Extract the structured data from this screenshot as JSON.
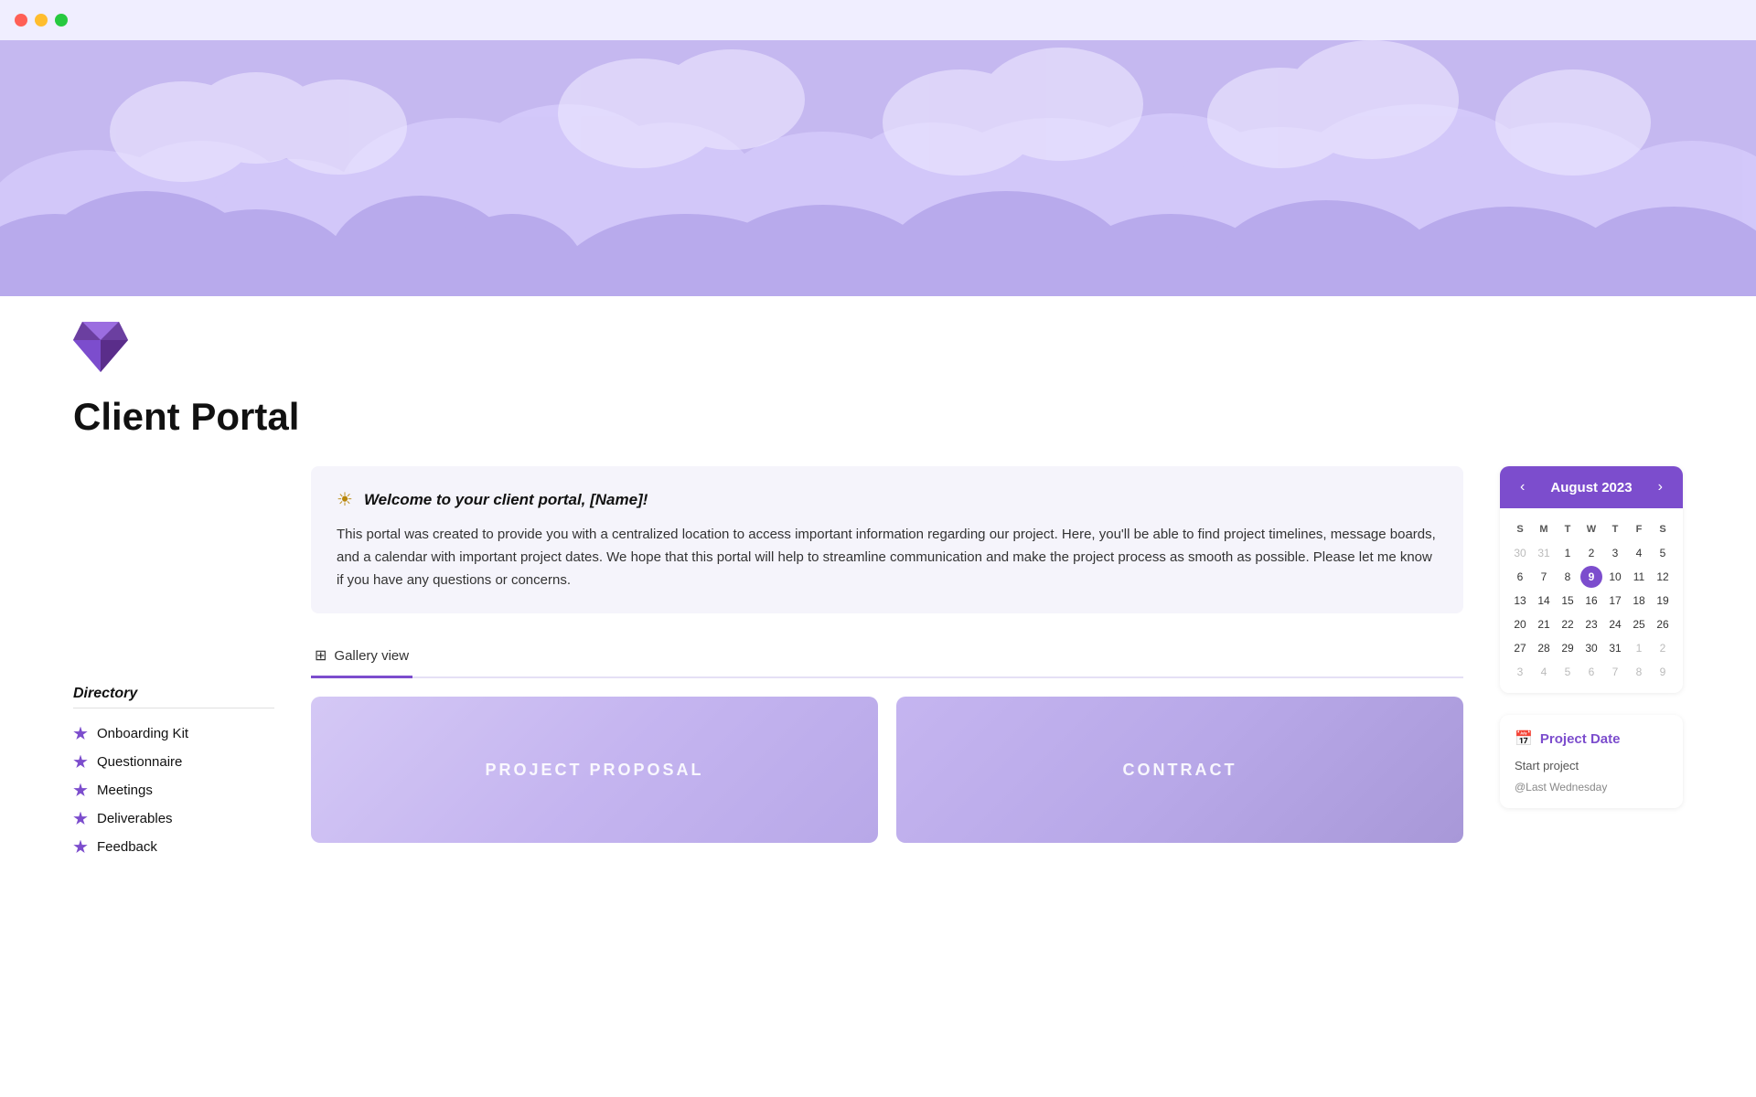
{
  "titlebar": {
    "btn_red": "close",
    "btn_yellow": "minimize",
    "btn_green": "maximize"
  },
  "hero": {
    "background_color": "#c5b8f0"
  },
  "icon": {
    "type": "diamond",
    "color": "#6b3fa0"
  },
  "page": {
    "title": "Client Portal"
  },
  "welcome": {
    "icon": "☀",
    "title": "Welcome to your client portal, [Name]!",
    "body": "This portal was created to provide you with a centralized location to access important information regarding our project. Here, you'll be able to find project timelines, message boards, and a calendar with important project dates. We hope that this portal will help to streamline communication and make the project process as smooth as possible. Please let me know if you have any questions or concerns."
  },
  "gallery_tab": {
    "label": "Gallery view"
  },
  "cards": [
    {
      "id": "proposal",
      "label": "PROJECT PROPOSAL"
    },
    {
      "id": "contract",
      "label": "CONTRACT"
    }
  ],
  "sidebar": {
    "title": "Directory",
    "items": [
      {
        "label": "Onboarding Kit"
      },
      {
        "label": "Questionnaire"
      },
      {
        "label": "Meetings"
      },
      {
        "label": "Deliverables"
      },
      {
        "label": "Feedback"
      }
    ]
  },
  "calendar": {
    "prev_label": "‹",
    "next_label": "›",
    "month_year": "August 2023",
    "day_headers": [
      "S",
      "M",
      "T",
      "W",
      "T",
      "F",
      "S"
    ],
    "weeks": [
      [
        {
          "n": "30",
          "other": true
        },
        {
          "n": "31",
          "other": true
        },
        {
          "n": "1"
        },
        {
          "n": "2"
        },
        {
          "n": "3"
        },
        {
          "n": "4"
        },
        {
          "n": "5"
        }
      ],
      [
        {
          "n": "6"
        },
        {
          "n": "7"
        },
        {
          "n": "8"
        },
        {
          "n": "9",
          "today": true
        },
        {
          "n": "10"
        },
        {
          "n": "11"
        },
        {
          "n": "12"
        }
      ],
      [
        {
          "n": "13"
        },
        {
          "n": "14"
        },
        {
          "n": "15"
        },
        {
          "n": "16"
        },
        {
          "n": "17"
        },
        {
          "n": "18"
        },
        {
          "n": "19"
        }
      ],
      [
        {
          "n": "20"
        },
        {
          "n": "21"
        },
        {
          "n": "22"
        },
        {
          "n": "23"
        },
        {
          "n": "24"
        },
        {
          "n": "25"
        },
        {
          "n": "26"
        }
      ],
      [
        {
          "n": "27"
        },
        {
          "n": "28"
        },
        {
          "n": "29"
        },
        {
          "n": "30"
        },
        {
          "n": "31"
        },
        {
          "n": "1",
          "other": true
        },
        {
          "n": "2",
          "other": true
        }
      ],
      [
        {
          "n": "3",
          "other": true
        },
        {
          "n": "4",
          "other": true
        },
        {
          "n": "5",
          "other": true
        },
        {
          "n": "6",
          "other": true
        },
        {
          "n": "7",
          "other": true
        },
        {
          "n": "8",
          "other": true
        },
        {
          "n": "9",
          "other": true
        }
      ]
    ]
  },
  "project_date": {
    "title": "Project Date",
    "start_label": "Start project",
    "schedule_label": "@Last Wednesday"
  }
}
